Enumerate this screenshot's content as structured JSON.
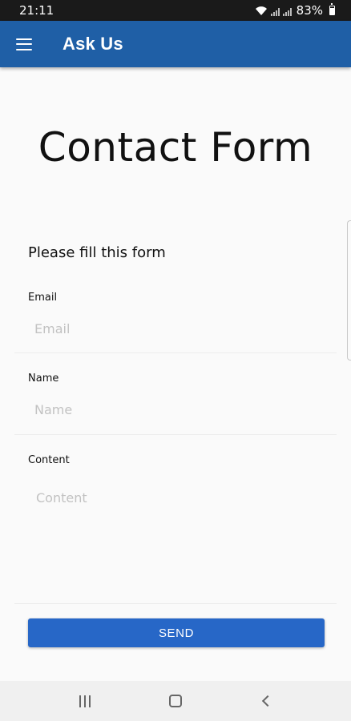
{
  "status_bar": {
    "time": "21:11",
    "battery": "83%"
  },
  "app_bar": {
    "title": "Ask Us",
    "menu_icon": "hamburger-menu-icon"
  },
  "page": {
    "title": "Contact Form",
    "form_heading": "Please fill this form"
  },
  "form": {
    "email": {
      "label": "Email",
      "placeholder": "Email",
      "value": ""
    },
    "name": {
      "label": "Name",
      "placeholder": "Name",
      "value": ""
    },
    "content": {
      "label": "Content",
      "placeholder": "Content",
      "value": ""
    },
    "send_label": "SEND"
  },
  "colors": {
    "app_bar": "#1f5fa6",
    "send_button": "#2767c7"
  },
  "nav_bar": {
    "icons": [
      "recent-apps-icon",
      "home-icon",
      "back-icon"
    ]
  }
}
